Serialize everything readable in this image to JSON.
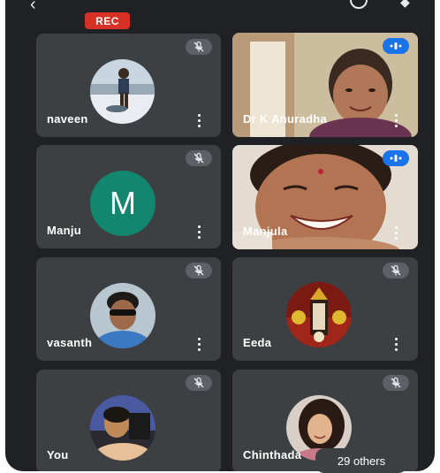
{
  "header": {
    "rec_label": "REC"
  },
  "tiles": [
    {
      "name": "naveen",
      "avatar_type": "photo",
      "muted": true
    },
    {
      "name": "Dr K Anuradha",
      "avatar_type": "video",
      "muted": false,
      "speaking": true
    },
    {
      "name": "Manju",
      "avatar_type": "initial",
      "initial": "M",
      "muted": true
    },
    {
      "name": "Manjula",
      "avatar_type": "video",
      "muted": false
    },
    {
      "name": "vasanth",
      "avatar_type": "photo",
      "muted": true
    },
    {
      "name": "Eeda",
      "avatar_type": "photo",
      "muted": true
    },
    {
      "name": "You",
      "avatar_type": "photo",
      "muted": true
    },
    {
      "name": "Chinthada",
      "avatar_type": "photo",
      "muted": true
    }
  ],
  "others_label": "29 others",
  "icons": {
    "mic_off": "mic-off-icon",
    "more": "more-vert-icon",
    "speaking": "audio-level-icon",
    "back": "back-arrow-icon"
  },
  "colors": {
    "background": "#202124",
    "tile": "#3c4043",
    "rec": "#d93025",
    "speaking_outline": "#1a73e8",
    "avatar_m": "#12866e"
  }
}
